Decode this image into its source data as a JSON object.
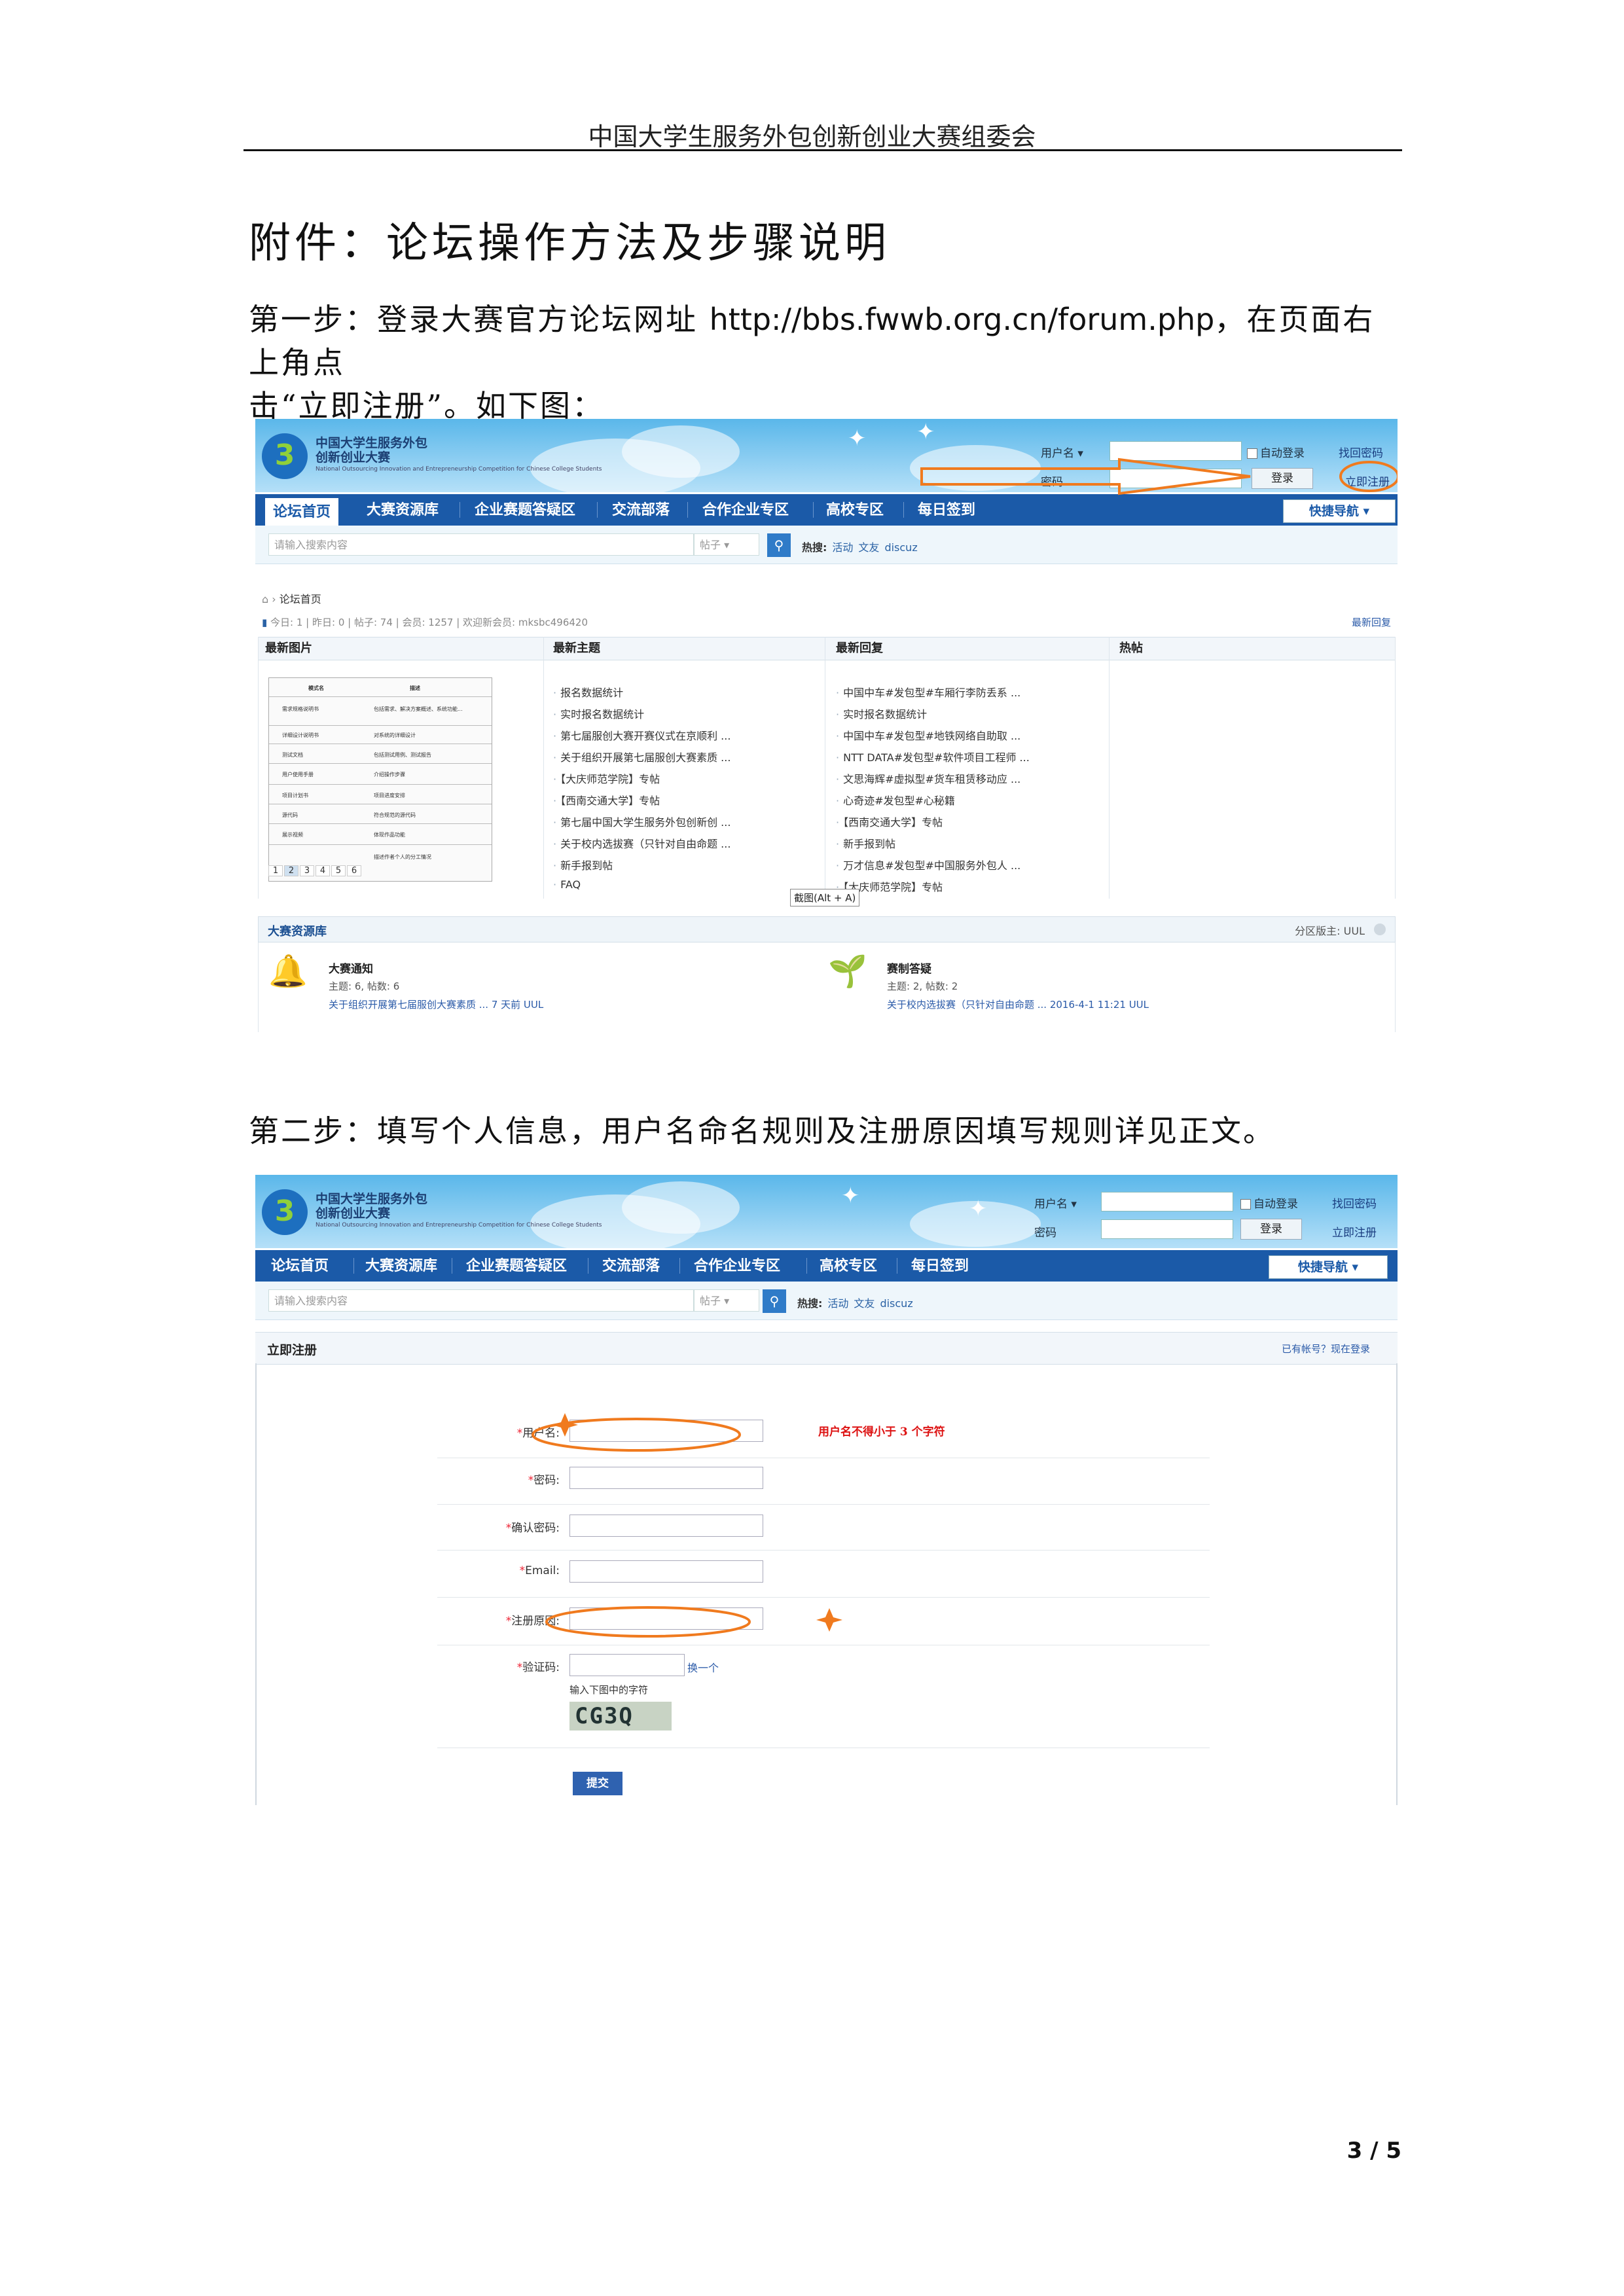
{
  "page": {
    "header": "中国大学生服务外包创新创业大赛组委会",
    "title": "附件：论坛操作方法及步骤说明",
    "step1_pre": "第一步：登录大赛官方论坛网址 ",
    "step1_url": "http://bbs.fwwb.org.cn/forum.php",
    "step1_post": "，在页面右上角点",
    "step1_line2": "击“立即注册”。如下图：",
    "step2": "第二步：填写个人信息，用户名命名规则及注册原因填写规则详见正文。",
    "page_number": "3 / 5"
  },
  "site": {
    "logo_line1": "中国大学生服务外包",
    "logo_line2": "创新创业大赛",
    "logo_en": "National Outsourcing Innovation and Entrepreneurship Competition for Chinese College Students",
    "username_label": "用户名",
    "password_label": "密码",
    "auto_login": "自动登录",
    "login_button": "登录",
    "forgot_password": "找回密码",
    "register_now": "立即注册",
    "nav": [
      "论坛首页",
      "大赛资源库",
      "企业赛题答疑区",
      "交流部落",
      "合作企业专区",
      "高校专区",
      "每日签到"
    ],
    "quick_nav": "快捷导航",
    "search_placeholder": "请输入搜索内容",
    "search_scope": "帖子",
    "hot_label": "热搜:",
    "hot_terms": [
      "活动",
      "文友",
      "discuz"
    ]
  },
  "shot1": {
    "breadcrumb": "论坛首页",
    "stats": "今日: 1  |  昨日: 0  |  帖子: 74  |  会员: 1257  |  欢迎新会员: mksbc496420",
    "latest_reply_link": "最新回复",
    "col_headers": [
      "最新图片",
      "最新主题",
      "最新回复",
      "热帖"
    ],
    "latest_topics": [
      "报名数据统计",
      "实时报名数据统计",
      "第七届服创大赛开赛仪式在京顺利 ...",
      "关于组织开展第七届服创大赛素质 ...",
      "【大庆师范学院】专帖",
      "【西南交通大学】专帖",
      "第七届中国大学生服务外包创新创 ...",
      "关于校内选拔赛（只针对自由命题 ...",
      "新手报到帖",
      "FAQ"
    ],
    "latest_replies": [
      "中国中车#发包型#车厢行李防丢系 ...",
      "实时报名数据统计",
      "中国中车#发包型#地铁网络自助取 ...",
      "NTT DATA#发包型#软件项目工程师 ...",
      "文思海辉#虚拟型#货车租赁移动应 ...",
      "心奇迹#发包型#心秘籍",
      "【西南交通大学】专帖",
      "新手报到帖",
      "万才信息#发包型#中国服务外包人 ...",
      "【大庆师范学院】专帖"
    ],
    "thumb_header": [
      "模式名",
      "描述"
    ],
    "thumb_rows": [
      [
        "需求规格说明书",
        "包括需求、解决方案概述、系统功能..."
      ],
      [
        "详细设计说明书",
        "对系统的详细设计"
      ],
      [
        "测试文档",
        "包括测试用例、测试报告"
      ],
      [
        "用户使用手册",
        "介绍操作步骤"
      ],
      [
        "项目计划书",
        "项目进度安排"
      ],
      [
        "源代码",
        "符合规范的源代码"
      ],
      [
        "展示视频",
        "体现作品功能"
      ],
      [
        "",
        "描述作者个人的分工情况"
      ]
    ],
    "pager": [
      "1",
      "2",
      "3",
      "4",
      "5",
      "6"
    ],
    "tooltip": "截图(Alt + A)",
    "section_title": "大赛资源库",
    "section_moderator": "分区版主: UUL",
    "forums": [
      {
        "title": "大赛通知",
        "meta": "主题: 6, 帖数: 6",
        "last": "关于组织开展第七届服创大赛素质 ... 7 天前 UUL"
      },
      {
        "title": "赛制答疑",
        "meta": "主题: 2, 帖数: 2",
        "last": "关于校内选拔赛（只针对自由命题 ... 2016-4-1 11:21 UUL"
      }
    ]
  },
  "shot2": {
    "register_title": "立即注册",
    "have_account": "已有帐号？现在登录",
    "fields": [
      {
        "label": "用户名:"
      },
      {
        "label": "密码:"
      },
      {
        "label": "确认密码:"
      },
      {
        "label": "Email:"
      },
      {
        "label": "注册原因:"
      },
      {
        "label": "验证码:"
      }
    ],
    "username_hint": "用户名不得小于 3 个字符",
    "captcha_change": "换一个",
    "captcha_prompt": "输入下图中的字符",
    "captcha_text": "CG3Q",
    "submit": "提交"
  },
  "colors": {
    "nav_blue": "#1b5aa8",
    "annotation_orange": "#f07a1e",
    "required_red": "#e23333"
  }
}
